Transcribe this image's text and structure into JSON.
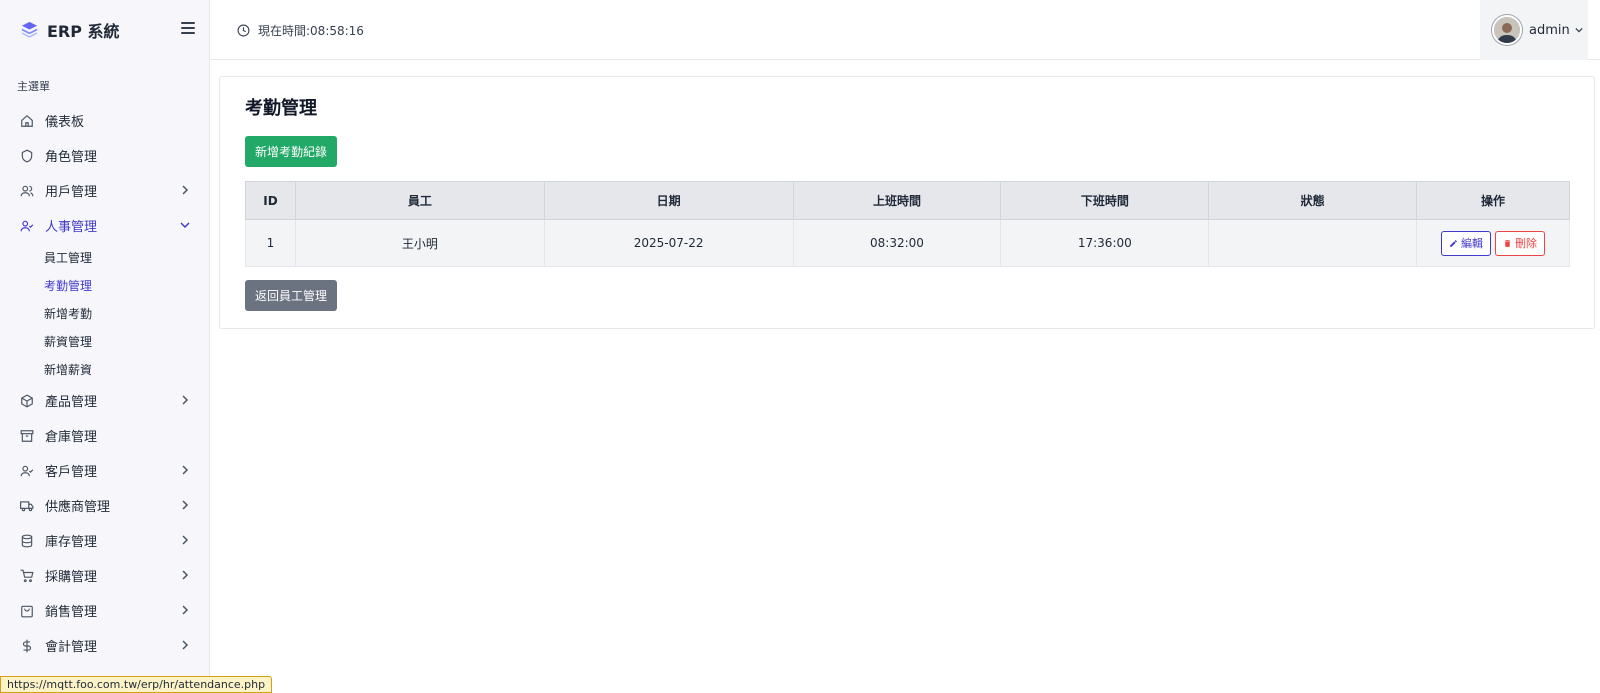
{
  "app": {
    "brand": "ERP 系統",
    "accent": "#4338ca"
  },
  "header": {
    "clock_text": "現在時間:08:58:16",
    "user_name": "admin"
  },
  "sidebar": {
    "section_title": "主選單",
    "items": [
      {
        "label": "儀表板",
        "icon": "home-icon"
      },
      {
        "label": "角色管理",
        "icon": "shield-icon"
      },
      {
        "label": "用戶管理",
        "icon": "users-icon"
      },
      {
        "label": "人事管理",
        "icon": "user-check-icon"
      },
      {
        "label": "產品管理",
        "icon": "box-icon"
      },
      {
        "label": "倉庫管理",
        "icon": "archive-icon"
      },
      {
        "label": "客戶管理",
        "icon": "user-check-icon"
      },
      {
        "label": "供應商管理",
        "icon": "truck-icon"
      },
      {
        "label": "庫存管理",
        "icon": "database-icon"
      },
      {
        "label": "採購管理",
        "icon": "cart-icon"
      },
      {
        "label": "銷售管理",
        "icon": "shopping-bag-icon"
      },
      {
        "label": "會計管理",
        "icon": "dollar-icon"
      }
    ],
    "hr_sub": [
      {
        "label": "員工管理"
      },
      {
        "label": "考勤管理"
      },
      {
        "label": "新增考勤"
      },
      {
        "label": "薪資管理"
      },
      {
        "label": "新增薪資"
      }
    ]
  },
  "main": {
    "title": "考勤管理",
    "add_button": "新增考勤紀錄",
    "back_button": "返回員工管理",
    "table": {
      "headers": [
        "ID",
        "員工",
        "日期",
        "上班時間",
        "下班時間",
        "狀態",
        "操作"
      ],
      "rows": [
        {
          "id": "1",
          "employee": "王小明",
          "date": "2025-07-22",
          "clock_in": "08:32:00",
          "clock_out": "17:36:00",
          "status": "",
          "edit": "編輯",
          "delete": "刪除"
        }
      ]
    }
  },
  "statusbar": {
    "url": "https://mqtt.foo.com.tw/erp/hr/attendance.php"
  }
}
